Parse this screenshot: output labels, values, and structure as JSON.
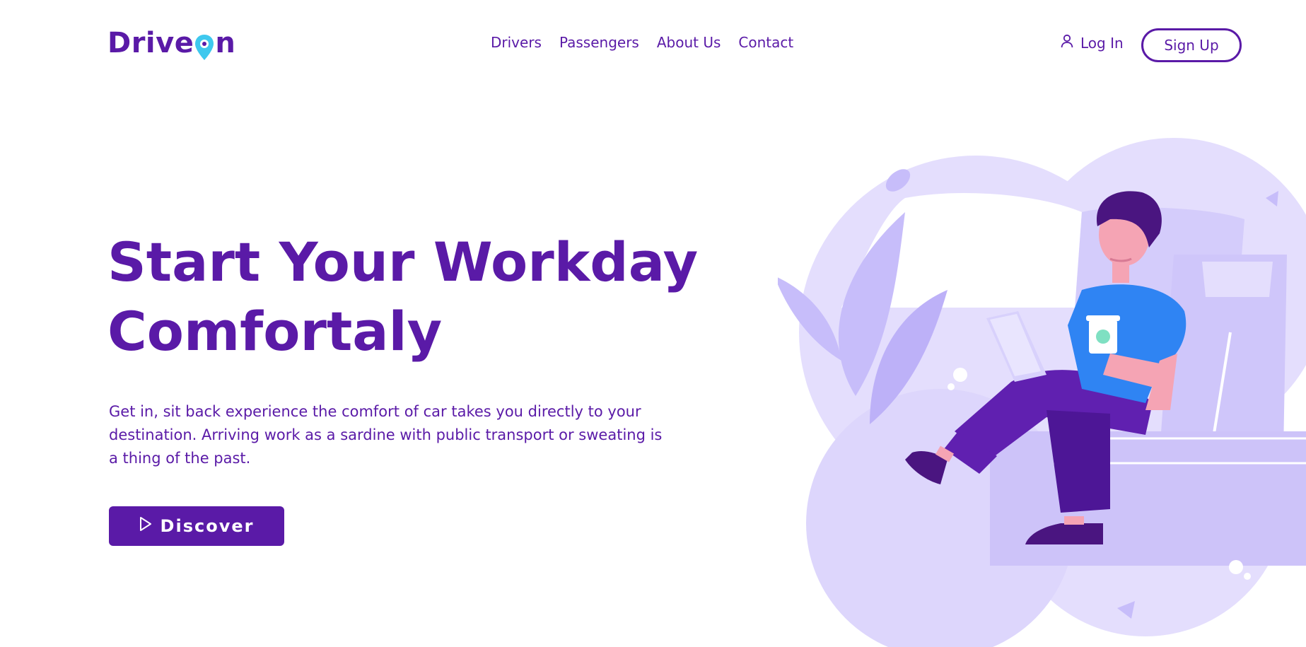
{
  "brand": {
    "logo_text_before": "Drive",
    "logo_text_after": "n",
    "logo_pin_icon": "map-pin-icon",
    "primary_color": "#5a1aa7",
    "accent_color": "#3ec8ee"
  },
  "nav": {
    "items": [
      {
        "label": "Drivers"
      },
      {
        "label": "Passengers"
      },
      {
        "label": "About Us"
      },
      {
        "label": "Contact"
      }
    ]
  },
  "auth": {
    "login_label": "Log In",
    "login_icon": "user-icon",
    "signup_label": "Sign Up"
  },
  "hero": {
    "title_line1": "Start Your Workday",
    "title_line2": "Comfortaly",
    "description": "Get in, sit back experience the comfort of car takes you directly to your destination. Arriving work as a sardine with public transport or sweating is a thing of the past.",
    "cta_label": "Discover",
    "cta_icon": "play-icon"
  },
  "illustration": {
    "subject": "person-with-coffee-and-tablet-icon"
  }
}
